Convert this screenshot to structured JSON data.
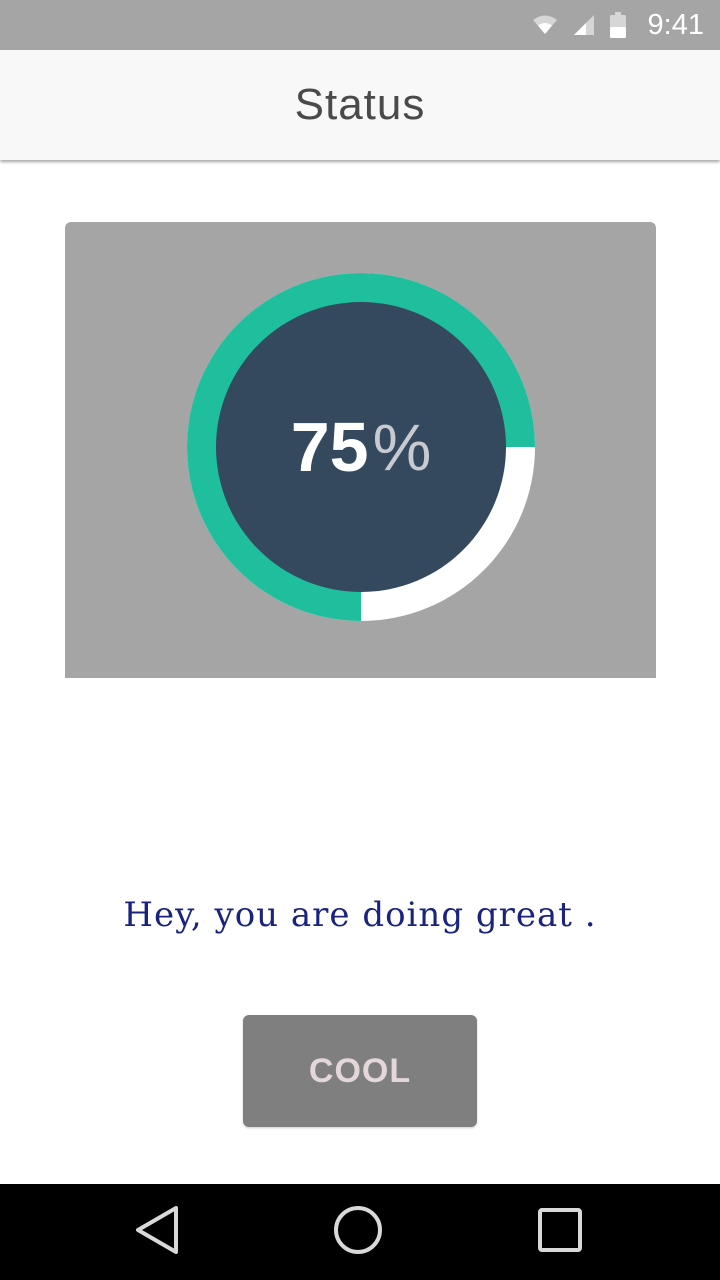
{
  "status_bar": {
    "time": "9:41",
    "icons": [
      "wifi-icon",
      "cell-signal-icon",
      "battery-icon"
    ]
  },
  "app_bar": {
    "title": "Status"
  },
  "progress": {
    "value_percent": 75,
    "number_text": "75",
    "symbol_text": "%",
    "progress_color": "#1fbf9e",
    "track_color": "#ffffff",
    "inner_color": "#34495e",
    "card_color": "#a5a5a5"
  },
  "message": "Hey, you are doing great .",
  "button": {
    "label": "COOL"
  },
  "nav_bar": {
    "icons": [
      "back-icon",
      "home-icon",
      "recents-icon"
    ]
  }
}
